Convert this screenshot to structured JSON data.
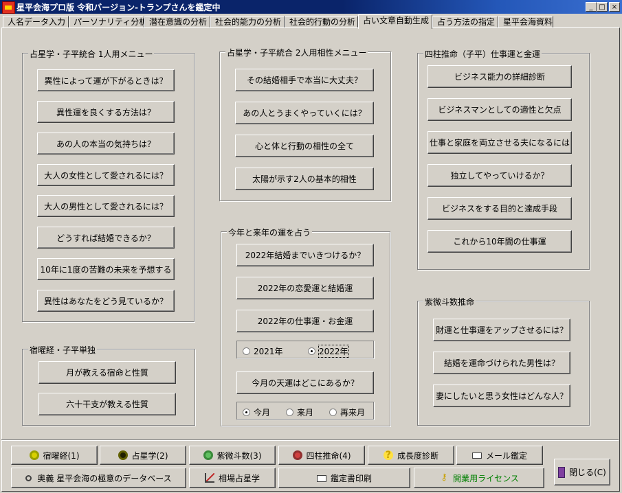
{
  "window": {
    "title": "星平会海プロ版 令和バージョン-トランプさんを鑑定中"
  },
  "tabs": [
    "人名データ入力",
    "パーソナリティ分析",
    "潜在意識の分析",
    "社会的能力の分析",
    "社会的行動の分析",
    "占い文章自動生成",
    "占う方法の指定",
    "星平会海資料"
  ],
  "active_tab": "占い文章自動生成",
  "group1": {
    "title": "占星学・子平統合 1人用メニュー",
    "buttons": [
      "異性によって運が下がるときは？",
      "異性運を良くする方法は？",
      "あの人の本当の気持ちは？",
      "大人の女性として愛されるには？",
      "大人の男性として愛されるには？",
      "どうすれば結婚できるか？",
      "10年に1度の苦難の未来を予想する",
      "異性はあなたをどう見ているか？"
    ]
  },
  "group2": {
    "title": "占星学・子平統合 2人用相性メニュー",
    "buttons": [
      "その結婚相手で本当に大丈夫？",
      "あの人とうまくやっていくには？",
      "心と体と行動の相性の全て",
      "太陽が示す2人の基本的相性"
    ]
  },
  "group3": {
    "title": "四柱推命（子平）仕事運と金運",
    "buttons": [
      "ビジネス能力の詳細診断",
      "ビジネスマンとしての適性と欠点",
      "仕事と家庭を両立させる夫になるには",
      "独立してやっていけるか？",
      "ビジネスをする目的と達成手段",
      "これから10年間の仕事運"
    ]
  },
  "group4": {
    "title": "今年と来年の運を占う",
    "buttons": [
      "2022年結婚までいきつけるか？",
      "2022年の恋愛運と結婚運",
      "2022年の仕事運・お金運"
    ],
    "year_options": [
      "2021年",
      "2022年"
    ],
    "year_selected": "2022年",
    "tenun_button": "今月の天運はどこにあるか？",
    "month_options": [
      "今月",
      "来月",
      "再来月"
    ],
    "month_selected": "今月"
  },
  "group5": {
    "title": "宿曜経・子平単独",
    "buttons": [
      "月が教える宿命と性質",
      "六十干支が教える性質"
    ]
  },
  "group6": {
    "title": "紫微斗数推命",
    "buttons": [
      "財運と仕事運をアップさせるには？",
      "結婚を運命づけられた男性は？",
      "妻にしたいと思う女性はどんな人？"
    ]
  },
  "bottom_row1": [
    "宿曜経(1)",
    "占星学(2)",
    "紫微斗数(3)",
    "四柱推命(4)",
    "成長度診断",
    "メール鑑定"
  ],
  "bottom_row2": [
    "奥義 星平会海の極意のデータベース",
    "相場占星学",
    "鑑定書印刷",
    "開業用ライセンス"
  ],
  "close_button": "閉じる(C)",
  "colors": {
    "title_bar": "#0a246a",
    "face": "#d4d0c8",
    "license_text": "#008000"
  }
}
